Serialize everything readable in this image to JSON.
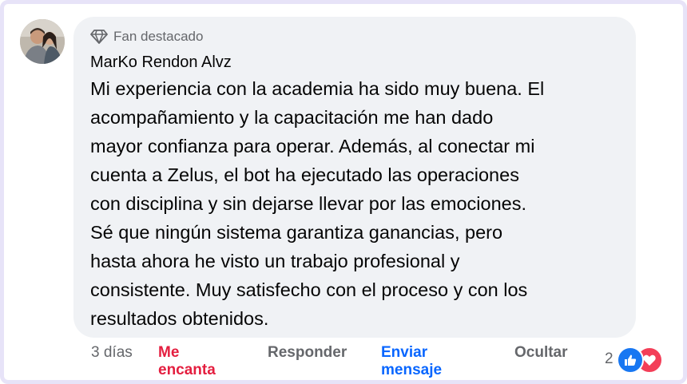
{
  "comment": {
    "badge": "Fan destacado",
    "author": "MarKo Rendon Alvz",
    "lines": [
      "Mi experiencia con la academia ha sido muy buena. El",
      "acompañamiento y la capacitación me han dado",
      "mayor confianza para operar. Además, al conectar mi",
      "cuenta a Zelus, el bot ha ejecutado las operaciones",
      "con disciplina y sin dejarse llevar por las emociones.",
      "Sé que ningún sistema garantiza ganancias, pero",
      "hasta ahora he visto un trabajo profesional y",
      "consistente. Muy satisfecho con el proceso y con los",
      "resultados obtenidos."
    ]
  },
  "actions": {
    "time": "3 días",
    "love": "Me encanta",
    "reply": "Responder",
    "message": "Enviar mensaje",
    "hide": "Ocultar"
  },
  "reactions": {
    "count": "2",
    "icons": [
      "like-icon",
      "love-icon"
    ]
  },
  "colors": {
    "bubble": "#f0f2f5",
    "love_active": "#e41e3f",
    "link_blue": "#0866ff",
    "secondary_text": "#65676b"
  }
}
